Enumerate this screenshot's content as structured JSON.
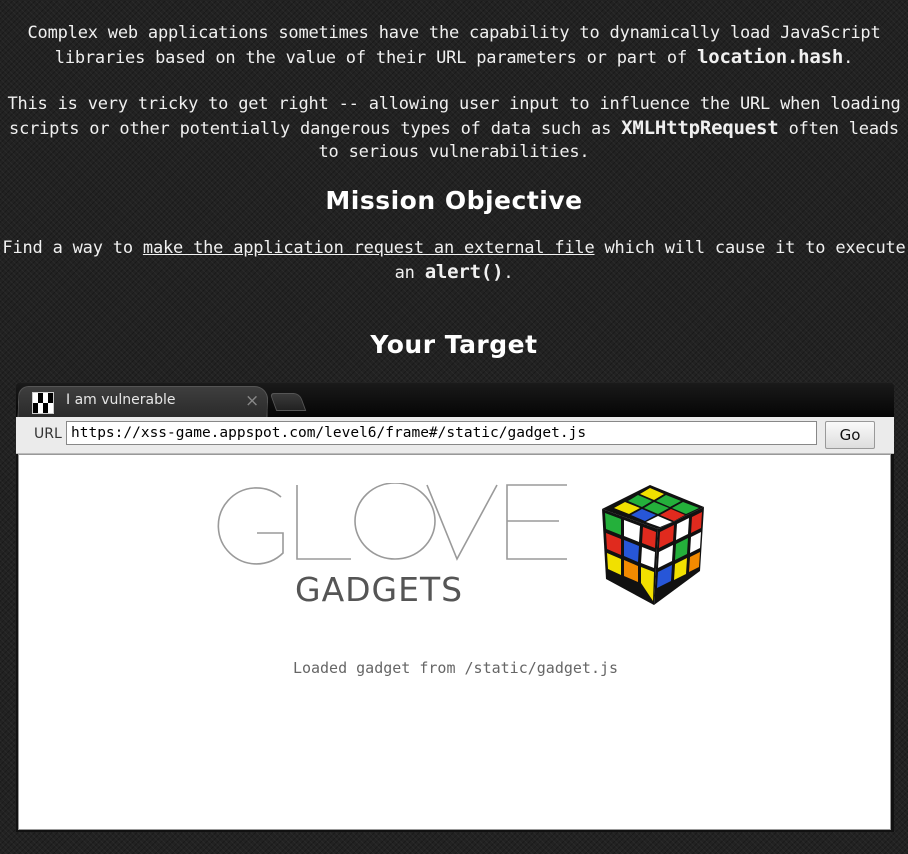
{
  "intro": {
    "p1_text_a": "Complex web applications sometimes have the capability to dynamically load JavaScript libraries based on the value of their URL parameters or part of ",
    "p1_code": "location.hash",
    "p1_text_b": ".",
    "p2_text_a": "This is very tricky to get right -- allowing user input to influence the URL when loading scripts or other potentially dangerous types of data such as ",
    "p2_code": "XMLHttpRequest",
    "p2_text_b": " often leads to serious vulnerabilities."
  },
  "objective": {
    "heading": "Mission Objective",
    "text_a": "Find a way to ",
    "link": "make the application request an external file",
    "text_b": " which will cause it to execute an ",
    "code": "alert()",
    "text_c": "."
  },
  "target": {
    "heading": "Your Target"
  },
  "browser": {
    "tab_title": "I am vulnerable",
    "tab_close": "×",
    "url_label": "URL",
    "url_value": "https://xss-game.appspot.com/level6/frame#/static/gadget.js",
    "go_label": "Go",
    "page": {
      "logo_text": "GLOVE",
      "logo_subtext": "GADGETS",
      "status": "Loaded gadget from /static/gadget.js"
    }
  }
}
